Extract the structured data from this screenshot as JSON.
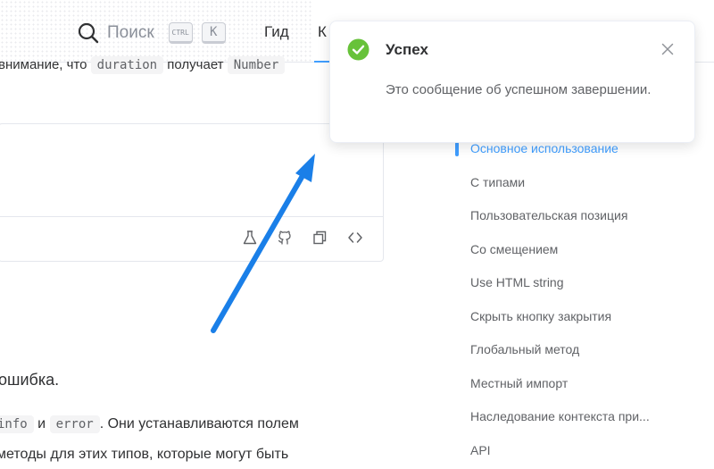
{
  "header": {
    "search_label": "Поиск",
    "kbd_ctrl": "CTRL",
    "kbd_k": "K",
    "nav_guide": "Гид",
    "nav_component": "К"
  },
  "content": {
    "line1_pre": "внимание, что",
    "line1_code1": "duration",
    "line1_mid": "получает",
    "line1_code2": "Number",
    "para_error": "ошибка.",
    "para2_code1": "info",
    "para2_and": "и",
    "para2_code2": "error",
    "para2_rest": ". Они устанавливаются полем",
    "para3": "методы для этих типов, которые могут быть"
  },
  "demo_toolbar": {
    "icons": [
      "experiment-icon",
      "github-icon",
      "copy-icon",
      "code-icon"
    ]
  },
  "toc": {
    "items": [
      {
        "label": "Основное использование",
        "active": true
      },
      {
        "label": "С типами",
        "active": false
      },
      {
        "label": "Пользовательская позиция",
        "active": false
      },
      {
        "label": "Со смещением",
        "active": false
      },
      {
        "label": "Use HTML string",
        "active": false
      },
      {
        "label": "Скрыть кнопку закрытия",
        "active": false
      },
      {
        "label": "Глобальный метод",
        "active": false
      },
      {
        "label": "Местный импорт",
        "active": false
      },
      {
        "label": "Наследование контекста при...",
        "active": false
      },
      {
        "label": "API",
        "active": false
      }
    ]
  },
  "notification": {
    "title": "Успех",
    "message": "Это сообщение об успешном завершении.",
    "icon": "success-check-icon",
    "type_color": "#67c23a"
  },
  "colors": {
    "accent": "#409eff",
    "arrow": "#1a7fe8",
    "success": "#67c23a"
  }
}
